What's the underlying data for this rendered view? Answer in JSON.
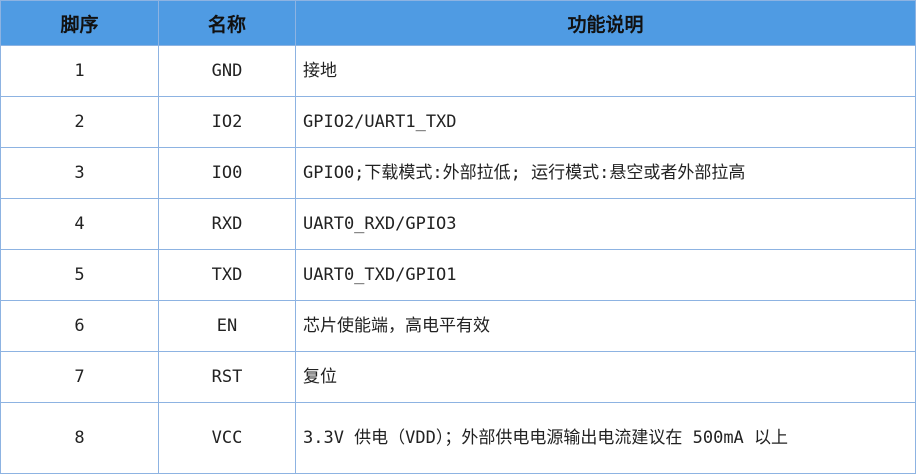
{
  "table": {
    "headers": [
      "脚序",
      "名称",
      "功能说明"
    ],
    "rows": [
      {
        "pin": "1",
        "name": "GND",
        "desc": "接地"
      },
      {
        "pin": "2",
        "name": "IO2",
        "desc": "GPIO2/UART1_TXD"
      },
      {
        "pin": "3",
        "name": "IO0",
        "desc": "GPIO0;下载模式:外部拉低; 运行模式:悬空或者外部拉高"
      },
      {
        "pin": "4",
        "name": "RXD",
        "desc": "UART0_RXD/GPIO3"
      },
      {
        "pin": "5",
        "name": "TXD",
        "desc": "UART0_TXD/GPIO1"
      },
      {
        "pin": "6",
        "name": "EN",
        "desc": "芯片使能端，高电平有效"
      },
      {
        "pin": "7",
        "name": "RST",
        "desc": "复位"
      },
      {
        "pin": "8",
        "name": "VCC",
        "desc": "3.3V 供电（VDD）；外部供电电源输出电流建议在 500mA 以上"
      }
    ]
  },
  "colors": {
    "header_bg": "#4f9be3",
    "border": "#8db3e2"
  }
}
